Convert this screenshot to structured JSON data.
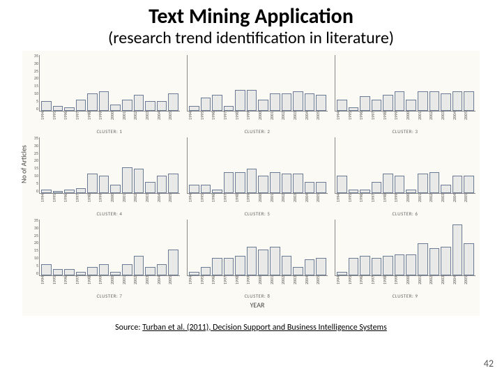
{
  "title": "Text Mining Application",
  "subtitle": "(research trend identification in literature)",
  "source_prefix": "Source: ",
  "source_cite": "Turban et al. (2011), Decision Support and Business Intelligence Systems",
  "page_number": "42",
  "chart_data": {
    "type": "bar",
    "title": "",
    "xlabel": "YEAR",
    "ylabel": "No of Articles",
    "ylim": [
      0,
      35
    ],
    "yticks": [
      0,
      5,
      10,
      15,
      20,
      25,
      30,
      35
    ],
    "categories": [
      "1994",
      "1995",
      "1996",
      "1997",
      "1998",
      "1999",
      "2000",
      "2001",
      "2002",
      "2003",
      "2004",
      "2005"
    ],
    "panels": [
      {
        "name": "CLUSTER: 1",
        "values": [
          6,
          3,
          2,
          7,
          11,
          12,
          4,
          7,
          10,
          6,
          6,
          11
        ]
      },
      {
        "name": "CLUSTER: 2",
        "values": [
          3,
          8,
          10,
          3,
          13,
          13,
          7,
          11,
          11,
          12,
          11,
          10
        ]
      },
      {
        "name": "CLUSTER: 3",
        "values": [
          7,
          2,
          9,
          7,
          10,
          12,
          7,
          12,
          12,
          11,
          12,
          12
        ]
      },
      {
        "name": "CLUSTER: 4",
        "values": [
          2,
          1,
          2,
          3,
          12,
          11,
          5,
          16,
          15,
          7,
          11,
          12
        ]
      },
      {
        "name": "CLUSTER: 5",
        "values": [
          5,
          5,
          2,
          13,
          13,
          15,
          11,
          13,
          12,
          12,
          7,
          7
        ]
      },
      {
        "name": "CLUSTER: 6",
        "values": [
          11,
          2,
          2,
          7,
          12,
          11,
          2,
          12,
          13,
          5,
          11,
          11
        ]
      },
      {
        "name": "CLUSTER: 7",
        "values": [
          7,
          4,
          4,
          2,
          5,
          7,
          2,
          7,
          12,
          5,
          7,
          16
        ]
      },
      {
        "name": "CLUSTER: 8",
        "values": [
          2,
          5,
          11,
          11,
          12,
          18,
          16,
          18,
          12,
          5,
          10,
          11
        ]
      },
      {
        "name": "CLUSTER: 9",
        "values": [
          2,
          11,
          12,
          11,
          12,
          13,
          13,
          20,
          17,
          18,
          32,
          20
        ]
      }
    ]
  }
}
